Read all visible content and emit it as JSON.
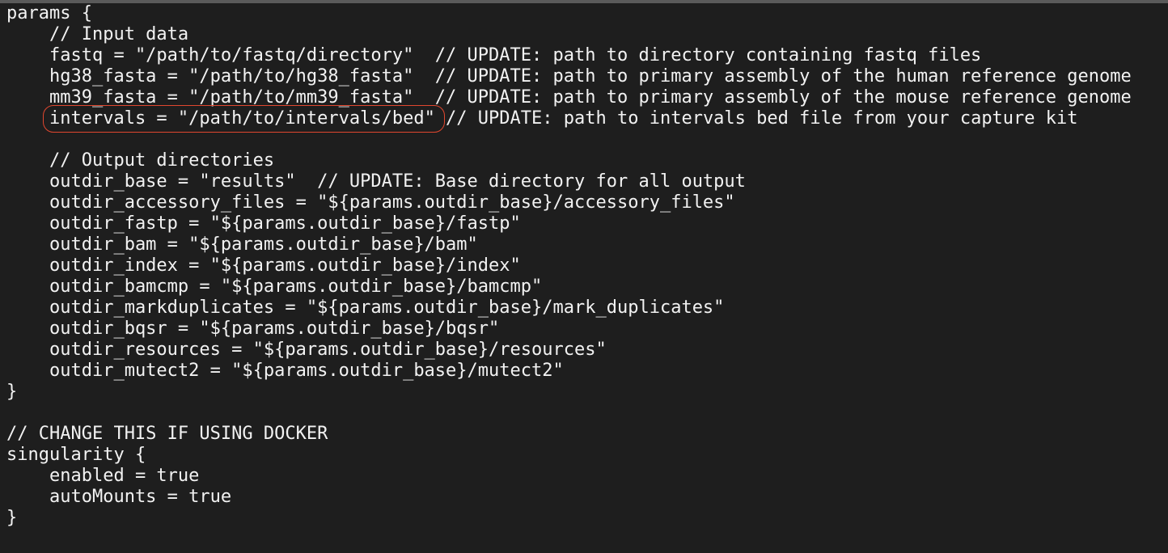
{
  "colors": {
    "background": "#1e1e1e",
    "text": "#f2f2f2",
    "annotation_circle": "#e0472f"
  },
  "lines": [
    {
      "text": "params {"
    },
    {
      "text": "    // Input data"
    },
    {
      "text": "    fastq = \"/path/to/fastq/directory\"  // UPDATE: path to directory containing fastq files"
    },
    {
      "text": "    hg38_fasta = \"/path/to/hg38_fasta\"  // UPDATE: path to primary assembly of the human reference genome"
    },
    {
      "text": "    mm39_fasta = \"/path/to/mm39_fasta\"  // UPDATE: path to primary assembly of the mouse reference genome"
    },
    {
      "indent": "    ",
      "highlight": "intervals = \"/path/to/intervals/bed\"",
      "text": " // UPDATE: path to intervals bed file from your capture kit"
    },
    {
      "text": ""
    },
    {
      "text": "    // Output directories"
    },
    {
      "text": "    outdir_base = \"results\"  // UPDATE: Base directory for all output"
    },
    {
      "text": "    outdir_accessory_files = \"${params.outdir_base}/accessory_files\""
    },
    {
      "text": "    outdir_fastp = \"${params.outdir_base}/fastp\""
    },
    {
      "text": "    outdir_bam = \"${params.outdir_base}/bam\""
    },
    {
      "text": "    outdir_index = \"${params.outdir_base}/index\""
    },
    {
      "text": "    outdir_bamcmp = \"${params.outdir_base}/bamcmp\""
    },
    {
      "text": "    outdir_markduplicates = \"${params.outdir_base}/mark_duplicates\""
    },
    {
      "text": "    outdir_bqsr = \"${params.outdir_base}/bqsr\""
    },
    {
      "text": "    outdir_resources = \"${params.outdir_base}/resources\""
    },
    {
      "text": "    outdir_mutect2 = \"${params.outdir_base}/mutect2\""
    },
    {
      "text": "}"
    },
    {
      "text": ""
    },
    {
      "text": "// CHANGE THIS IF USING DOCKER"
    },
    {
      "text": "singularity {"
    },
    {
      "text": "    enabled = true"
    },
    {
      "text": "    autoMounts = true"
    },
    {
      "text": "}"
    }
  ]
}
